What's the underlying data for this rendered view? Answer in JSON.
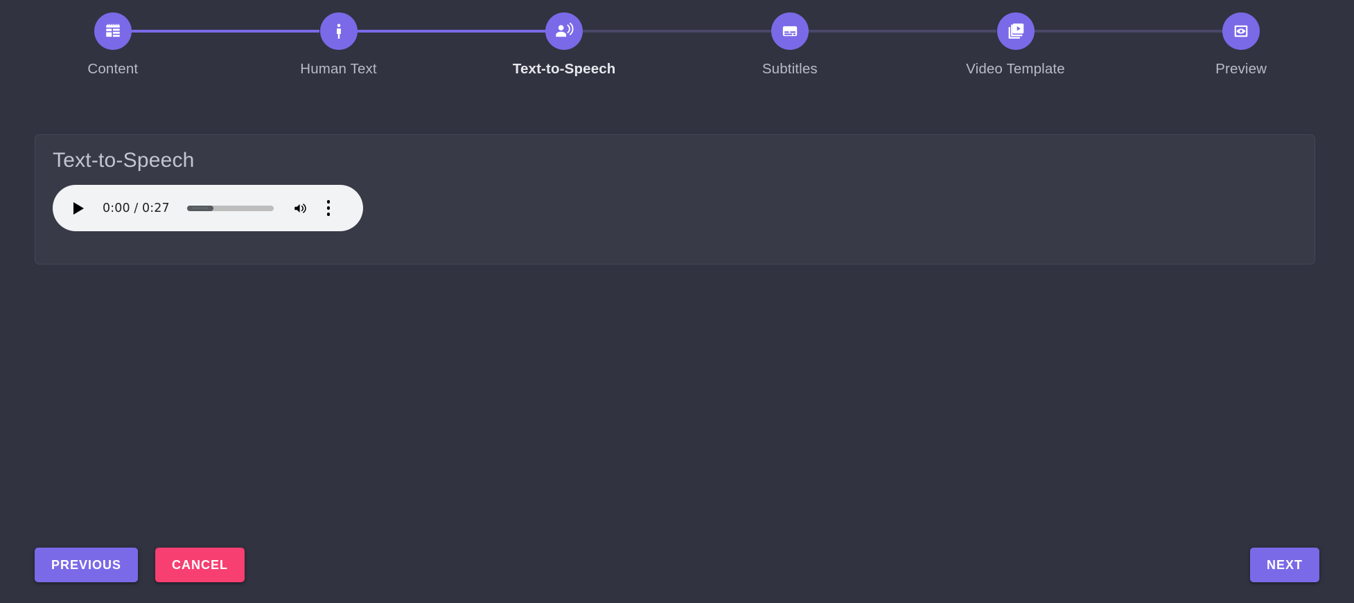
{
  "theme": {
    "page_bg": "#313340",
    "card_bg": "#383a47",
    "card_border": "#45475a",
    "accent": "#7a6ae8",
    "accent_dim": "#4b4768",
    "danger": "#f73f72",
    "label": "#b9bcc6",
    "label_active": "#e6e8ee",
    "player_bg": "#f1f3f4"
  },
  "stepper": {
    "active_index": 2,
    "steps": [
      {
        "label": "Content",
        "icon": "web-layout-icon",
        "state": "done"
      },
      {
        "label": "Human Text",
        "icon": "person-accessibility-icon",
        "state": "done"
      },
      {
        "label": "Text-to-Speech",
        "icon": "record-voice-over-icon",
        "state": "active"
      },
      {
        "label": "Subtitles",
        "icon": "subtitles-icon",
        "state": "todo"
      },
      {
        "label": "Video Template",
        "icon": "video-library-icon",
        "state": "todo"
      },
      {
        "label": "Preview",
        "icon": "preview-eye-icon",
        "state": "todo"
      }
    ]
  },
  "card": {
    "title": "Text-to-Speech",
    "audio": {
      "current_time": "0:00",
      "duration": "0:27",
      "time_display": "0:00 / 0:27",
      "progress_percent": 0,
      "play_icon": "play-icon",
      "volume_icon": "volume-up-icon",
      "menu_icon": "more-vert-icon",
      "muted": false
    }
  },
  "footer": {
    "previous_label": "PREVIOUS",
    "cancel_label": "CANCEL",
    "next_label": "NEXT"
  }
}
